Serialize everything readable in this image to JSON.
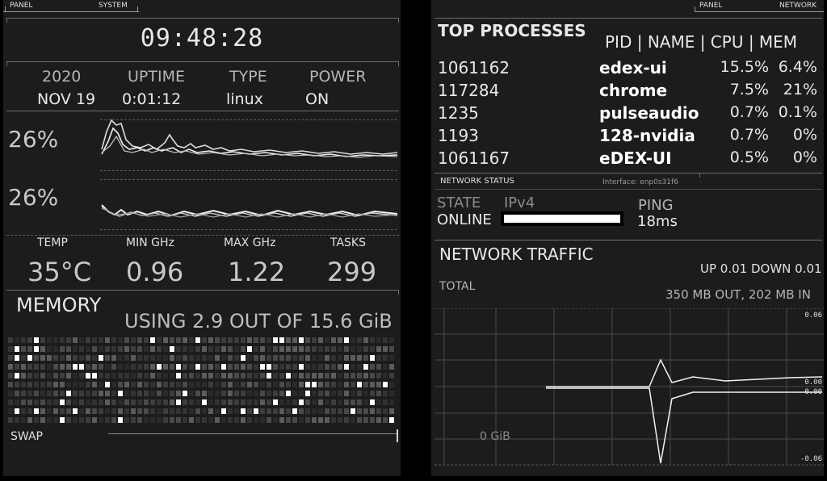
{
  "left": {
    "header": {
      "panel": "PANEL",
      "system": "SYSTEM"
    },
    "clock": "09:48:28",
    "info": {
      "year": "2020",
      "date": "NOV 19",
      "uptime_label": "UPTIME",
      "uptime": "0:01:12",
      "type_label": "TYPE",
      "type": "linux",
      "power_label": "POWER",
      "power": "ON"
    },
    "cpu": {
      "core1_pct": "26%",
      "core2_pct": "26%"
    },
    "sensors": {
      "temp_label": "TEMP",
      "temp": "35°C",
      "min_label": "MIN GHz",
      "min": "0.96",
      "max_label": "MAX GHz",
      "max": "1.22",
      "tasks_label": "TASKS",
      "tasks": "299"
    },
    "memory": {
      "title": "MEMORY",
      "usage": "USING 2.9 OUT OF 15.6 GiB",
      "used_fraction": 0.186,
      "swap_label": "SWAP"
    }
  },
  "right": {
    "header": {
      "panel": "PANEL",
      "network": "NETWORK"
    },
    "processes": {
      "title": "TOP PROCESSES",
      "columns": "PID | NAME | CPU | MEM",
      "rows": [
        {
          "pid": "1061162",
          "name": "edex-ui",
          "cpu": "15.5%",
          "mem": "6.4%"
        },
        {
          "pid": "117284",
          "name": "chrome",
          "cpu": "7.5%",
          "mem": "21%"
        },
        {
          "pid": "1235",
          "name": "pulseaudio",
          "cpu": "0.7%",
          "mem": "0.1%"
        },
        {
          "pid": "1193",
          "name": "128-nvidia",
          "cpu": "0.7%",
          "mem": "0%"
        },
        {
          "pid": "1061167",
          "name": "eDEX-UI",
          "cpu": "0.5%",
          "mem": "0%"
        }
      ]
    },
    "network_status": {
      "title": "NETWORK STATUS",
      "interface": "Interface: enp0s31f6",
      "state_label": "STATE",
      "ipv4_label": "IPv4",
      "ping_label": "PING",
      "state": "ONLINE",
      "ping": "18ms"
    },
    "traffic": {
      "title": "NETWORK TRAFFIC",
      "rates": "UP 0.01 DOWN 0.01",
      "total_label": "TOTAL",
      "total": "350 MB OUT, 202 MB IN",
      "axis_top": "0.06",
      "axis_mid1": "0.00",
      "axis_mid2": "0.00",
      "axis_bottom": "-0.06",
      "gib": "0 GiB"
    }
  },
  "colors": {
    "panel_bg": "#1c1c1c",
    "page_bg": "#000000",
    "text": "#e8e8e8"
  }
}
